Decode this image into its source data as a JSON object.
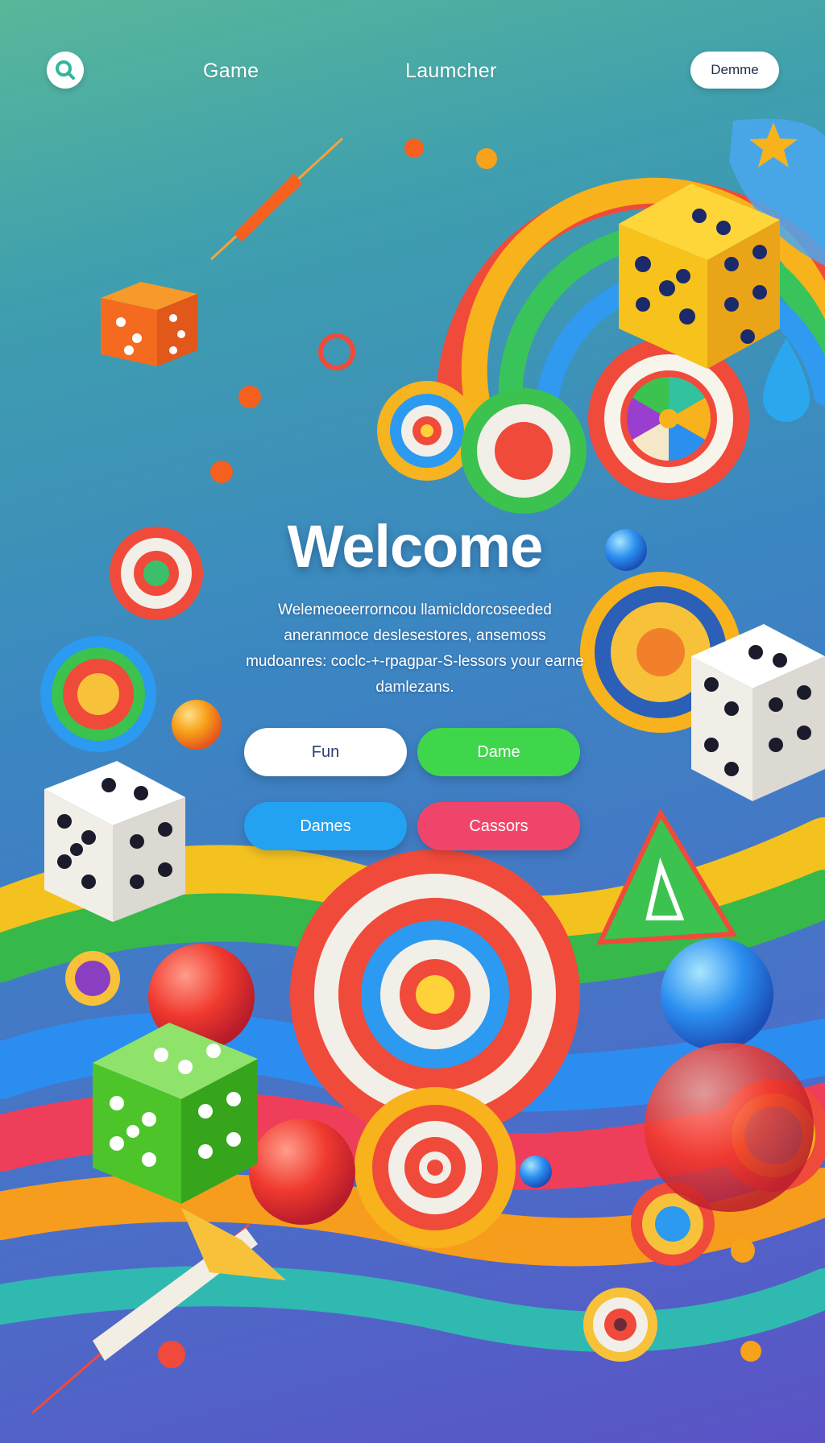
{
  "header": {
    "search_icon": "search-icon",
    "nav_left": "Game",
    "nav_right": "Laumcher",
    "pill_button": "Demme"
  },
  "hero": {
    "title": "Welcome",
    "body": "Welemeoeerrorncou llamicldorcoseeded aneranmoce deslesestores, ansemoss mudoanres: coclc-+-rpagpar-S-lessors your earne damlezans."
  },
  "actions": {
    "fun": "Fun",
    "dame": "Dame",
    "dames": "Dames",
    "cassors": "Cassors"
  },
  "decor_icons": [
    "dice-icon",
    "target-icon",
    "dart-icon",
    "ball-icon",
    "star-icon",
    "triangle-icon",
    "wheel-icon",
    "drop-icon"
  ]
}
